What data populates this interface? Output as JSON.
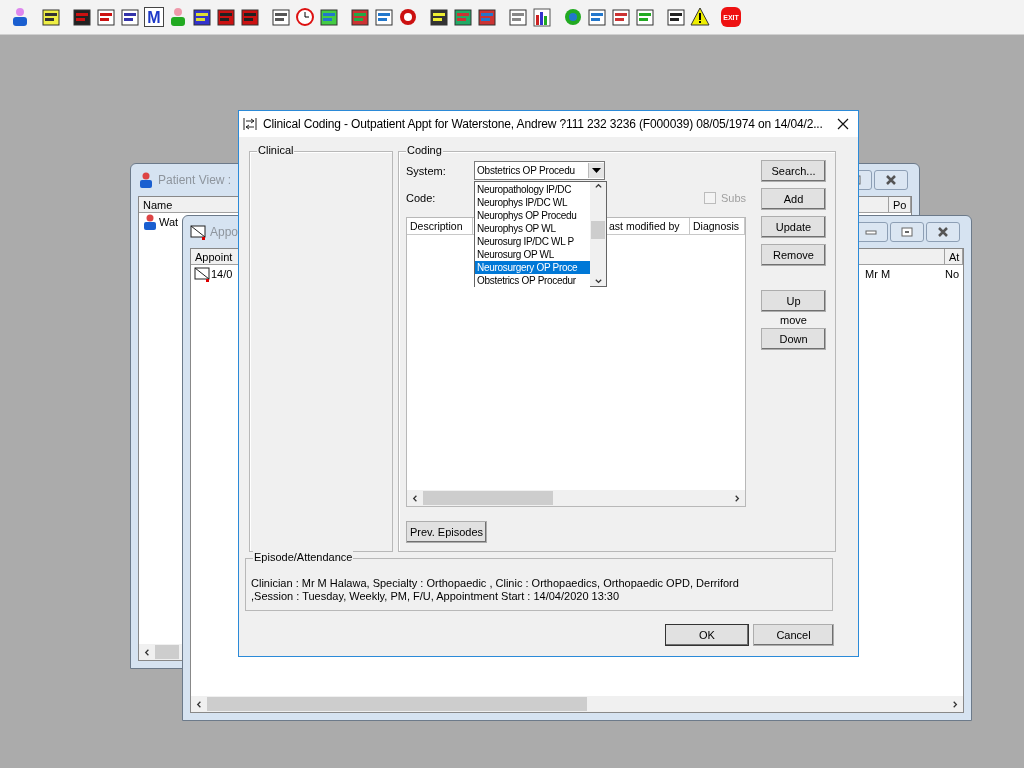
{
  "toolbar": {
    "letter": "M",
    "exit_label": "EXIT"
  },
  "patient_window": {
    "title": "Patient View :",
    "columns": [
      "Name",
      "Po"
    ],
    "row": "Wat"
  },
  "appointment_window": {
    "title": "Appo",
    "columns": [
      "Appoint",
      "At"
    ],
    "row": [
      "14/0",
      "Mr M",
      "No"
    ]
  },
  "dialog": {
    "title": "Clinical Coding - Outpatient Appt for Waterstone, Andrew ?111 232 3236 (F000039) 08/05/1974 on 14/04/2...",
    "clinical_group": "Clinical",
    "coding_group": "Coding",
    "system_label": "System:",
    "system_value": "Obstetrics OP Procedu",
    "system_options": [
      {
        "label": "Neuropathology IP/DC",
        "selected": false
      },
      {
        "label": "Neurophys IP/DC WL",
        "selected": false
      },
      {
        "label": "Neurophys OP Procedu",
        "selected": false
      },
      {
        "label": "Neurophys OP WL",
        "selected": false
      },
      {
        "label": "Neurosurg IP/DC WL P",
        "selected": false
      },
      {
        "label": "Neurosurg OP WL",
        "selected": false
      },
      {
        "label": "Neurosurgery OP Proce",
        "selected": true
      },
      {
        "label": "Obstetrics OP Procedur",
        "selected": false
      }
    ],
    "code_label": "Code:",
    "subs": {
      "label": "Subs",
      "checked": false,
      "disabled": true
    },
    "table_columns": [
      "Description",
      "ast modified by",
      "Diagnosis"
    ],
    "buttons": [
      "Search...",
      "Add",
      "Update",
      "Remove"
    ],
    "move": {
      "up": "Up",
      "label": "move",
      "down": "Down"
    },
    "prev_button": "Prev. Episodes",
    "episode": {
      "title": "Episode/Attendance",
      "lines": [
        "Clinician :  Mr M Halawa, Specialty : Orthopaedic , Clinic : Orthopaedics, Orthopaedic OPD, Derriford",
        ",Session : Tuesday, Weekly, PM, F/U, Appointment Start : 14/04/2020  13:30"
      ]
    },
    "ok": "OK",
    "cancel": "Cancel"
  }
}
